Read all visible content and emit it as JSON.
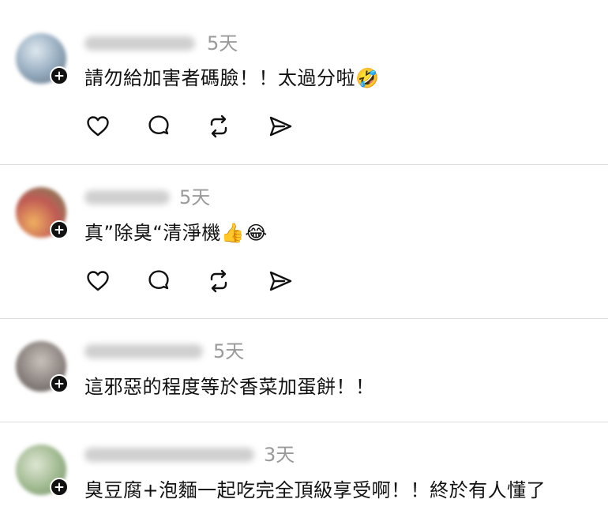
{
  "comments": [
    {
      "time": "5天",
      "text": "請勿給加害者碼臉！！太過分啦🤣",
      "avatar_colors": [
        "#dfe8ef",
        "#9fb4c6",
        "#5a6f82"
      ]
    },
    {
      "time": "5天",
      "text": "真”除臭“清淨機👍😂",
      "avatar_colors": [
        "#f0b060",
        "#c05a55",
        "#6f8a5a"
      ]
    },
    {
      "time": "5天",
      "text": "這邪惡的程度等於香菜加蛋餅！！",
      "avatar_colors": [
        "#c9c0bb",
        "#8e8682",
        "#5b5450"
      ]
    },
    {
      "time": "3天",
      "text": "臭豆腐+泡麵一起吃完全頂級享受啊！！終於有人懂了",
      "avatar_colors": [
        "#dfe6d4",
        "#9fb98f",
        "#6e8a62"
      ]
    }
  ],
  "icons": {
    "like": "heart-icon",
    "reply": "comment-bubble-icon",
    "repost": "repost-icon",
    "share": "send-icon",
    "follow": "plus-icon"
  }
}
